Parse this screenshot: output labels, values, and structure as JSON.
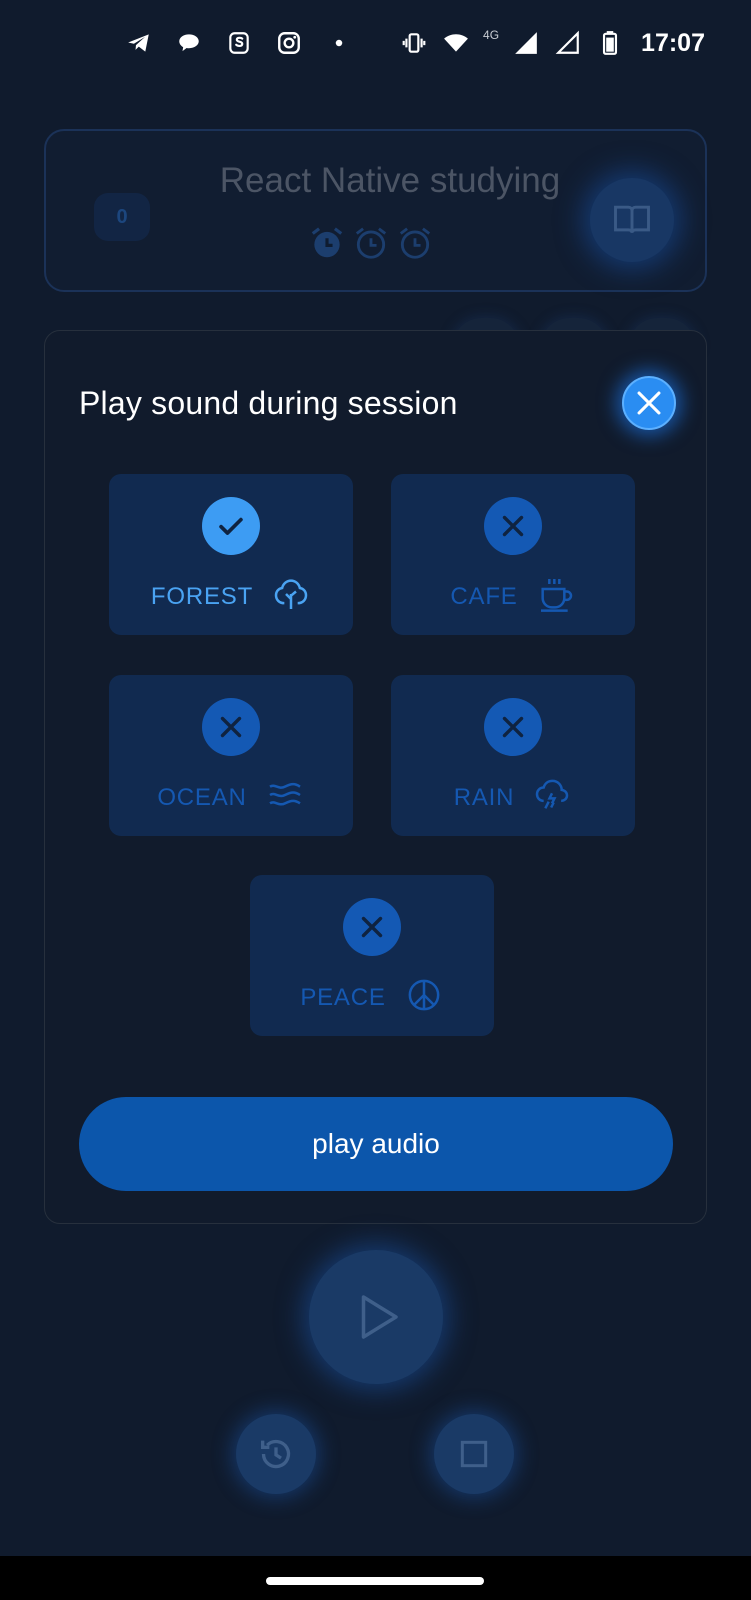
{
  "status_bar": {
    "time": "17:07",
    "network_label": "4G",
    "left_icons": [
      "telegram-icon",
      "chat-bubble-icon",
      "skype-icon",
      "instagram-icon",
      "notification-dot-icon"
    ],
    "right_icons": [
      "vibrate-icon",
      "wifi-icon",
      "signal-icon",
      "signal-empty-icon",
      "battery-icon"
    ]
  },
  "task_card": {
    "count": "0",
    "title": "React Native studying",
    "alarm_icons": [
      "alarm-filled-icon",
      "alarm-outline-icon",
      "alarm-outline-icon"
    ],
    "action_icon": "book-icon"
  },
  "modal": {
    "title": "Play sound during session",
    "close_icon": "close-icon",
    "sounds": [
      {
        "label": "FOREST",
        "selected": true,
        "icon": "tree-icon"
      },
      {
        "label": "CAFE",
        "selected": false,
        "icon": "coffee-cup-icon"
      },
      {
        "label": "OCEAN",
        "selected": false,
        "icon": "waves-icon"
      },
      {
        "label": "RAIN",
        "selected": false,
        "icon": "rain-cloud-icon"
      },
      {
        "label": "PEACE",
        "selected": false,
        "icon": "peace-icon"
      }
    ],
    "play_button_label": "play audio"
  },
  "controls": {
    "play_icon": "play-icon",
    "history_icon": "history-icon",
    "stop_icon": "stop-icon"
  },
  "colors": {
    "background": "#101b2d",
    "accent": "#2a8df2",
    "tile_bg": "#112a50",
    "selected_label": "#4aa3f2",
    "unselected_label": "#1558b1",
    "primary_button": "#0c56ab"
  }
}
